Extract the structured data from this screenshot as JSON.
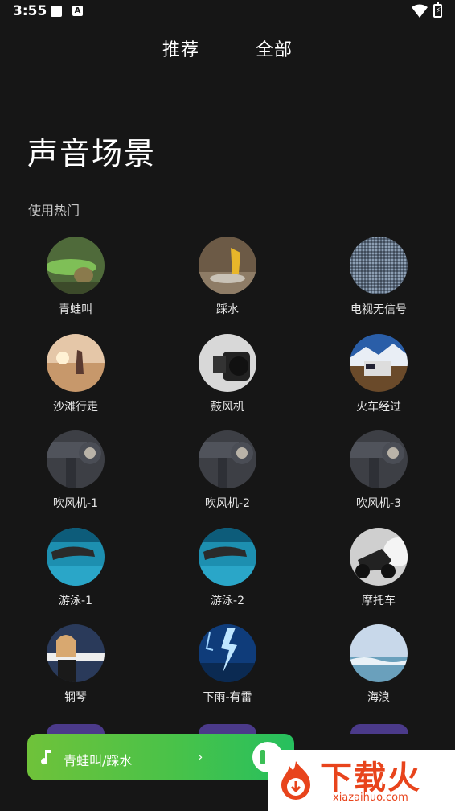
{
  "status_bar": {
    "time": "3:55",
    "a_badge": "A",
    "battery_glyph": "⚡"
  },
  "tabs": [
    {
      "label": "推荐"
    },
    {
      "label": "全部"
    }
  ],
  "page_title": "声音场景",
  "section_label": "使用热门",
  "items": [
    {
      "label": "青蛙叫",
      "thumb": "frog"
    },
    {
      "label": "踩水",
      "thumb": "splash"
    },
    {
      "label": "电视无信号",
      "thumb": "static"
    },
    {
      "label": "沙滩行走",
      "thumb": "beach"
    },
    {
      "label": "鼓风机",
      "thumb": "blower"
    },
    {
      "label": "火车经过",
      "thumb": "train"
    },
    {
      "label": "吹风机-1",
      "thumb": "hairdryer"
    },
    {
      "label": "吹风机-2",
      "thumb": "hairdryer"
    },
    {
      "label": "吹风机-3",
      "thumb": "hairdryer"
    },
    {
      "label": "游泳-1",
      "thumb": "swim"
    },
    {
      "label": "游泳-2",
      "thumb": "swim"
    },
    {
      "label": "摩托车",
      "thumb": "motorcycle"
    },
    {
      "label": "钢琴",
      "thumb": "piano"
    },
    {
      "label": "下雨-有雷",
      "thumb": "thunder"
    },
    {
      "label": "海浪",
      "thumb": "waves"
    }
  ],
  "player": {
    "title": "青蛙叫/踩水",
    "chevron": "›"
  },
  "watermark": {
    "text": "下载火",
    "url": "xiazaihuo.com"
  },
  "colors": {
    "background": "#161616",
    "player_start": "#6fc23a",
    "player_end": "#26c05e",
    "watermark": "#e8441c"
  }
}
